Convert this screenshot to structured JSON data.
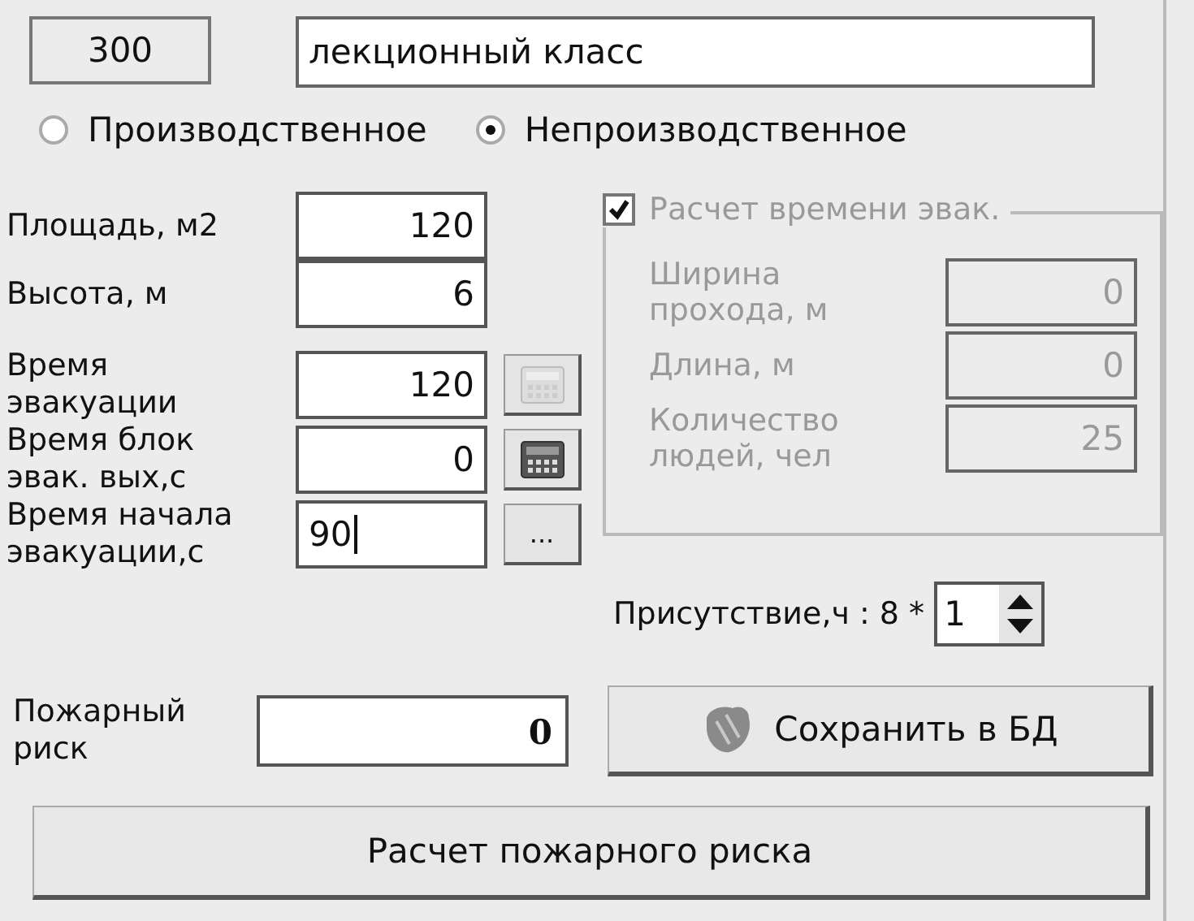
{
  "record": {
    "number": "300",
    "name": "лекционный класс"
  },
  "room_type": [
    {
      "label": "Производственное",
      "selected": false
    },
    {
      "label": "Непроизводственное",
      "selected": true
    }
  ],
  "fields": [
    {
      "label": "Площадь, м2",
      "value": "120"
    },
    {
      "label": "Высота, м",
      "value": "6"
    },
    {
      "label": "Время\nэвакуации",
      "value": "120",
      "button": {
        "kind": "calculator",
        "disabled": true
      }
    },
    {
      "label": "Время блок\nэвак. вых,с",
      "value": "0",
      "button": {
        "kind": "calculator",
        "disabled": false
      }
    },
    {
      "label": "Время начала\nэвакуации,с",
      "value": "90",
      "focused": true,
      "button": {
        "kind": "ellipsis",
        "label": "...",
        "disabled": false
      }
    }
  ],
  "evac_group": {
    "checkbox": {
      "label": "Расчет времени эвак.",
      "checked": true
    },
    "disabled": true,
    "fields": [
      {
        "label": "Ширина\nпрохода, м",
        "value": "0"
      },
      {
        "label": "Длина, м",
        "value": "0"
      },
      {
        "label": "Количество\nлюдей, чел",
        "value": "25"
      }
    ]
  },
  "presence": {
    "label": "Присутствие,ч : 8 *",
    "value": "1"
  },
  "fire_risk": {
    "label": "Пожарный\nриск",
    "value": "0"
  },
  "save_button": {
    "label": "Сохранить в БД"
  },
  "calc_button": {
    "label": "Расчет пожарного риска"
  }
}
